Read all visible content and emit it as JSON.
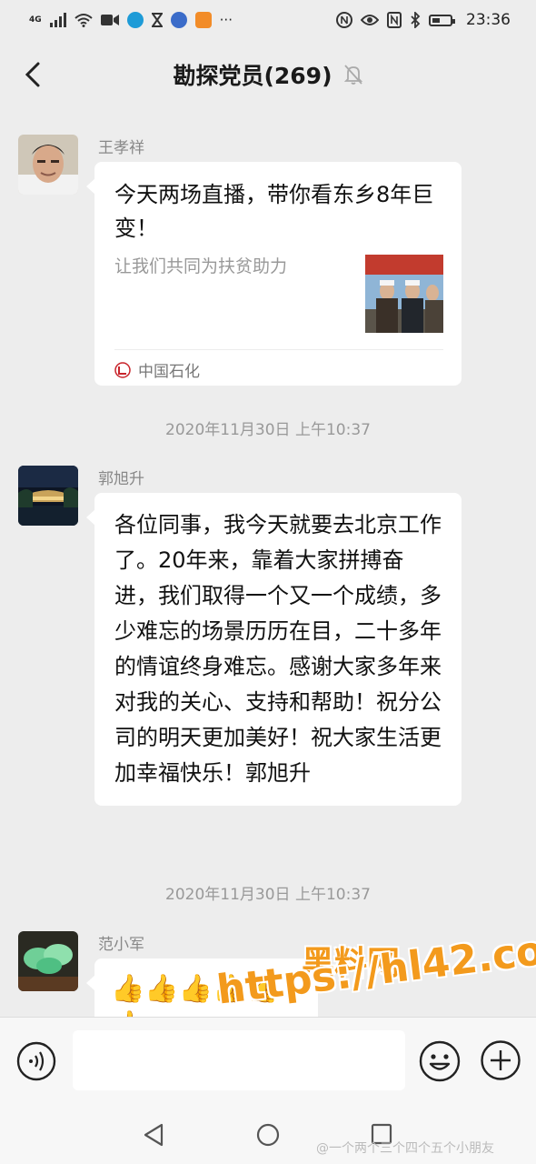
{
  "status_bar": {
    "network": "4G",
    "more": "···",
    "time": "23:36",
    "icons": [
      "signal-icon",
      "wifi-icon",
      "video-icon",
      "app-icon",
      "hourglass-icon",
      "app-icon",
      "play-icon",
      "nfc-icon",
      "eye-icon",
      "n-icon",
      "bluetooth-icon",
      "battery-icon"
    ]
  },
  "header": {
    "title": "勘探党员(269)",
    "back_icon": "chevron-left-icon",
    "mute_icon": "bell-muted-icon"
  },
  "messages": [
    {
      "sender": "王孝祥",
      "type": "link-card",
      "card": {
        "title": "今天两场直播，带你看东乡8年巨变！",
        "description": "让我们共同为扶贫助力",
        "source": "中国石化"
      }
    },
    {
      "timestamp": "2020年11月30日 上午10:37"
    },
    {
      "sender": "郭旭升",
      "type": "text",
      "text": "各位同事，我今天就要去北京工作了。20年来，靠着大家拼搏奋进，我们取得一个又一个成绩，多少难忘的场景历历在目，二十多年的情谊终身难忘。感谢大家多年来对我的关心、支持和帮助！祝分公司的明天更加美好！祝大家生活更加幸福快乐！郭旭升"
    },
    {
      "timestamp": "2020年11月30日 上午10:37"
    },
    {
      "sender": "范小军",
      "type": "emoji",
      "emoji": "👍👍👍👍👍👍"
    }
  ],
  "watermark": {
    "line1": "黑料网",
    "line2": "https://hl42.co"
  },
  "input_bar": {
    "voice_icon": "voice-icon",
    "emoji_icon": "smiley-icon",
    "plus_icon": "plus-circle-icon"
  },
  "nav_bar": {
    "back_icon": "triangle-back-icon",
    "home_icon": "circle-home-icon",
    "recent_icon": "square-recent-icon"
  },
  "weibo_credit": "@一个两个三个四个五个小朋友",
  "colors": {
    "background": "#ededed",
    "bubble": "#ffffff",
    "watermark": "#f39a1c"
  }
}
